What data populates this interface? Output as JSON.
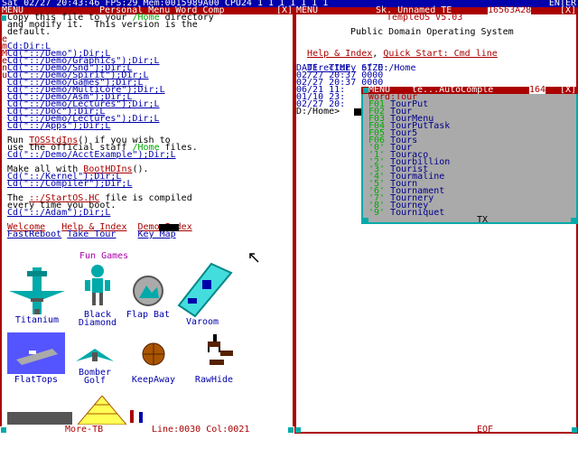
{
  "topbar": {
    "status": "Sat 02/27 20:43:46 FPS:29 Mem:0015989A00 CPU24 1 1 1 1 1 1 1",
    "enter": "ENTER"
  },
  "left_window": {
    "title_menu": "MENU",
    "title_tabs": "Personal Menu Word Comp",
    "title_controls": "[X]",
    "side_letters": [
      "e",
      "m",
      "M",
      "e",
      "n",
      "u"
    ],
    "lines": [
      {
        "segments": [
          {
            "t": "Copy this file to your ",
            "c": "black"
          },
          {
            "t": "/Home",
            "c": "green"
          },
          {
            "t": " directory",
            "c": "black"
          }
        ]
      },
      {
        "segments": [
          {
            "t": "and modify it.  This version is the",
            "c": "black"
          }
        ]
      },
      {
        "segments": [
          {
            "t": "default.",
            "c": "black"
          }
        ]
      },
      {
        "segments": [
          {
            "t": "",
            "c": "black"
          }
        ]
      },
      {
        "segments": [
          {
            "t": "Cd:Dir:L",
            "c": "link"
          }
        ]
      },
      {
        "segments": [
          {
            "t": "Cd(\"::/Demo\");Dir;L",
            "c": "link"
          }
        ]
      },
      {
        "segments": [
          {
            "t": "Cd(\"::/Demo/Graphics\");Dir;L",
            "c": "link"
          }
        ]
      },
      {
        "segments": [
          {
            "t": "Cd(\"::/Demo/Snd\");Dir;L",
            "c": "link"
          }
        ]
      },
      {
        "segments": [
          {
            "t": "Cd(\"::/Demo/Spirit\");Dir;L",
            "c": "link"
          }
        ]
      },
      {
        "segments": [
          {
            "t": "Cd(\"::/Demo/Games\");Dir;L",
            "c": "link"
          }
        ]
      },
      {
        "segments": [
          {
            "t": "Cd(\"::/Demo/MultiCore\");Dir;L",
            "c": "link"
          }
        ]
      },
      {
        "segments": [
          {
            "t": "Cd(\"::/Demo/Asm\");Dir;L",
            "c": "link"
          }
        ]
      },
      {
        "segments": [
          {
            "t": "Cd(\"::/Demo/Lectures\");Dir;L",
            "c": "link"
          }
        ]
      },
      {
        "segments": [
          {
            "t": "Cd(\"::/Doc\");Dir;L",
            "c": "link"
          }
        ]
      },
      {
        "segments": [
          {
            "t": "Cd(\"::/Demo/Lectures\");Dir;L",
            "c": "link"
          }
        ]
      },
      {
        "segments": [
          {
            "t": "Cd(\"::/Apps\");Dir;L",
            "c": "link"
          }
        ]
      },
      {
        "segments": [
          {
            "t": "",
            "c": "black"
          }
        ]
      },
      {
        "segments": [
          {
            "t": "Run ",
            "c": "black"
          },
          {
            "t": "TOSStdIns",
            "c": "redlink"
          },
          {
            "t": "() if you wish to",
            "c": "black"
          }
        ]
      },
      {
        "segments": [
          {
            "t": "use the official staff ",
            "c": "black"
          },
          {
            "t": "/Home",
            "c": "green"
          },
          {
            "t": " files.",
            "c": "black"
          }
        ]
      },
      {
        "segments": [
          {
            "t": "Cd(\"::/Demo/AcctExample\");Dir;L",
            "c": "link"
          }
        ]
      },
      {
        "segments": [
          {
            "t": "",
            "c": "black"
          }
        ]
      },
      {
        "segments": [
          {
            "t": "Make all with ",
            "c": "black"
          },
          {
            "t": "BootHDIns",
            "c": "redlink"
          },
          {
            "t": "().",
            "c": "black"
          }
        ]
      },
      {
        "segments": [
          {
            "t": "Cd(\"::/Kernel\");Dir;L",
            "c": "link"
          }
        ]
      },
      {
        "segments": [
          {
            "t": "Cd(\"::/Compiler\");Dir;L",
            "c": "link"
          }
        ]
      },
      {
        "segments": [
          {
            "t": "",
            "c": "black"
          }
        ]
      },
      {
        "segments": [
          {
            "t": "The ",
            "c": "black"
          },
          {
            "t": "::/StartOS.HC",
            "c": "redlink"
          },
          {
            "t": " file is compiled",
            "c": "black"
          }
        ]
      },
      {
        "segments": [
          {
            "t": "every time you boot.",
            "c": "black"
          }
        ]
      },
      {
        "segments": [
          {
            "t": "Cd(\"::/Adam\");Dir;L",
            "c": "link"
          }
        ]
      },
      {
        "segments": [
          {
            "t": "",
            "c": "black"
          }
        ]
      },
      {
        "segments": [
          {
            "t": "Welcome",
            "c": "redlink"
          },
          {
            "t": "   ",
            "c": "black"
          },
          {
            "t": "Help & Index",
            "c": "redlink"
          },
          {
            "t": "  ",
            "c": "black"
          },
          {
            "t": "Demo Index",
            "c": "redlink"
          }
        ]
      },
      {
        "segments": [
          {
            "t": "FastReboot",
            "c": "link"
          },
          {
            "t": " ",
            "c": "black"
          },
          {
            "t": "Take Tour",
            "c": "link"
          },
          {
            "t": "    ",
            "c": "black"
          },
          {
            "t": "Key Map",
            "c": "link"
          }
        ]
      }
    ],
    "fun_games": "Fun Games",
    "games": [
      {
        "name": "Titanium",
        "label": "Titanium"
      },
      {
        "name": "BlackDiamond",
        "label": "Black\nDiamond"
      },
      {
        "name": "FlapBat",
        "label": "Flap\nBat"
      },
      {
        "name": "Varoom",
        "label": "Varoom"
      },
      {
        "name": "FlatTops",
        "label": "FlatTops"
      },
      {
        "name": "BomberGolf",
        "label": "Bomber\nGolf"
      },
      {
        "name": "KeepAway",
        "label": "KeepAway"
      },
      {
        "name": "RawHide",
        "label": "RawHide"
      }
    ],
    "status_more": "More-TB",
    "status_line": "Line:0030 Col:0021"
  },
  "right_window": {
    "title_menu": "MENU",
    "title_tabs": "Sk. Unnamed TE",
    "title_addr": "16563A28",
    "title_controls": "[X]",
    "header_title": "TempleOS V5.03",
    "header_sub": "Public Domain Operating System",
    "help_link": "Help & Index",
    "quickstart_link": "Quick Start: Cmd line",
    "dir_label": "Directory",
    "dir_path": " of D:/Home",
    "dir_header": "DATE  TIME  SIZE",
    "dir_rows": [
      "02/27 20:37 0000",
      "02/27 20:37 0000",
      "06/21 11:",
      "01/10 23:",
      "02/27 20:"
    ],
    "prompt": "D:/Home>",
    "eof": "EOF"
  },
  "autocomplete": {
    "title_menu": "MENU",
    "title_text": "te...AutoComple",
    "title_addr": "164",
    "title_controls": "[X]",
    "word_label": "Word:Tour",
    "items": [
      {
        "key": "F01",
        "word": "TourPut"
      },
      {
        "key": "F02",
        "word": "Tour"
      },
      {
        "key": "F03",
        "word": "TourMenu"
      },
      {
        "key": "F04",
        "word": "TourPutTask"
      },
      {
        "key": "F05",
        "word": "Tour5"
      },
      {
        "key": "F06",
        "word": "Tours"
      },
      {
        "key": "'0'",
        "word": "Tour"
      },
      {
        "key": "'1'",
        "word": "Touraco"
      },
      {
        "key": "'2'",
        "word": "Tourbillion"
      },
      {
        "key": "'3'",
        "word": "Tourist"
      },
      {
        "key": "'4'",
        "word": "Tourmaline"
      },
      {
        "key": "'5'",
        "word": "Tourn"
      },
      {
        "key": "'6'",
        "word": "Tournament"
      },
      {
        "key": "'7'",
        "word": "Tournery"
      },
      {
        "key": "'8'",
        "word": "Tourney"
      },
      {
        "key": "'9'",
        "word": "Tourniquet"
      }
    ],
    "footer": "TX"
  }
}
